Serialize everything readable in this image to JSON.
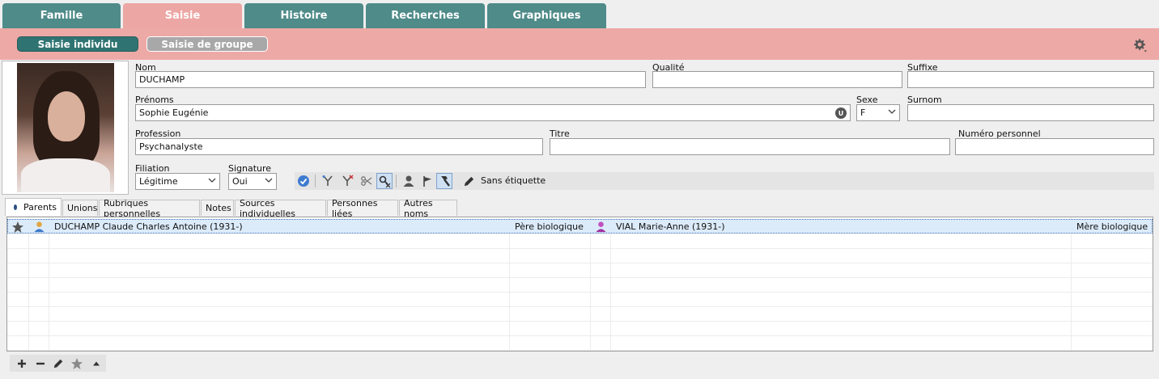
{
  "top_tabs": [
    {
      "label": "Famille"
    },
    {
      "label": "Saisie"
    },
    {
      "label": "Histoire"
    },
    {
      "label": "Recherches"
    },
    {
      "label": "Graphiques"
    }
  ],
  "mode_buttons": {
    "individual": "Saisie individu",
    "group": "Saisie de groupe"
  },
  "form": {
    "nom": {
      "label": "Nom",
      "value": "DUCHAMP"
    },
    "qualite": {
      "label": "Qualité",
      "value": ""
    },
    "suffixe": {
      "label": "Suffixe",
      "value": ""
    },
    "prenoms": {
      "label": "Prénoms",
      "value": "Sophie Eugénie",
      "badge": "U"
    },
    "sexe": {
      "label": "Sexe",
      "value": "F"
    },
    "surnom": {
      "label": "Surnom",
      "value": ""
    },
    "profession": {
      "label": "Profession",
      "value": "Psychanalyste"
    },
    "titre": {
      "label": "Titre",
      "value": ""
    },
    "numero": {
      "label": "Numéro personnel",
      "value": ""
    },
    "filiation": {
      "label": "Filiation",
      "value": "Légitime"
    },
    "signature": {
      "label": "Signature",
      "value": "Oui"
    }
  },
  "toolbar": {
    "tag_label": "Sans étiquette"
  },
  "sub_tabs": [
    {
      "label": "Parents"
    },
    {
      "label": "Unions"
    },
    {
      "label": "Rubriques personnelles"
    },
    {
      "label": "Notes"
    },
    {
      "label": "Sources individuelles"
    },
    {
      "label": "Personnes liées"
    },
    {
      "label": "Autres noms"
    }
  ],
  "parents_rows": [
    {
      "father": "DUCHAMP Claude Charles Antoine (1931-)",
      "father_relation": "Père biologique",
      "mother": "VIAL Marie-Anne (1931-)",
      "mother_relation": "Mère biologique"
    }
  ],
  "colors": {
    "teal": "#4e8b89",
    "pink": "#eca6a4",
    "selected_row": "#dcebfa"
  }
}
